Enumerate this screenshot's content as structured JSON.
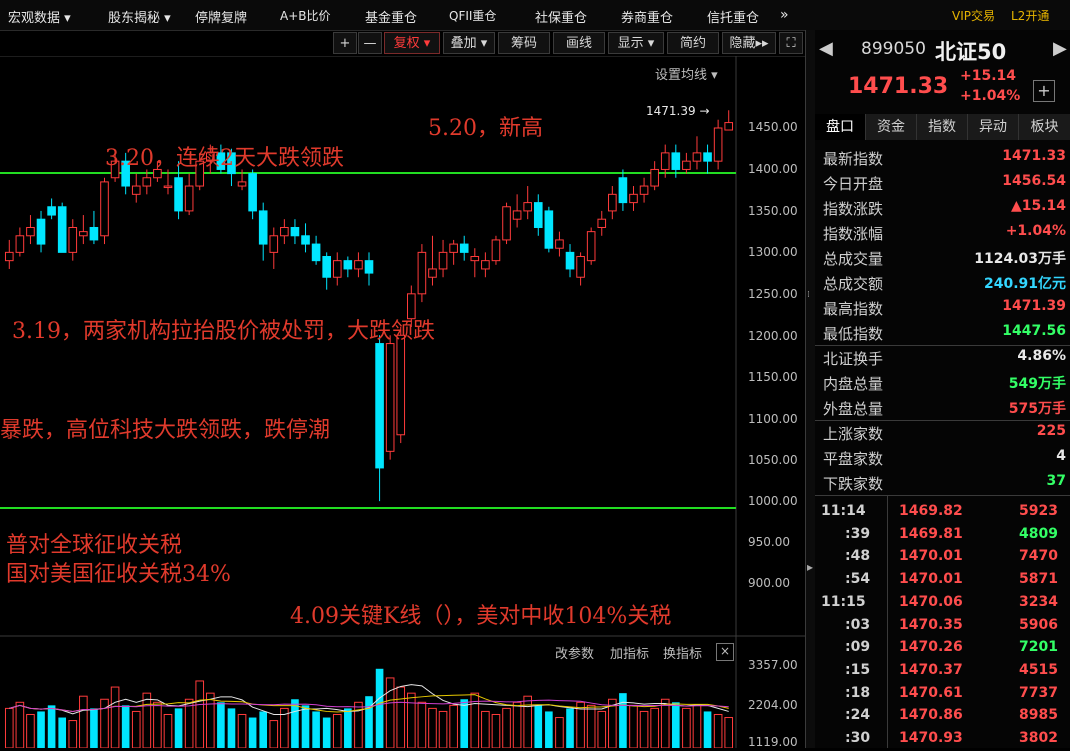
{
  "menu": {
    "items": [
      "宏观数据",
      "股东揭秘",
      "停牌复牌",
      "A+B比价",
      "基金重仓",
      "QFII重仓",
      "社保重仓",
      "券商重仓",
      "信托重仓"
    ],
    "more": "»",
    "vip": "VIP交易",
    "l2": "L2开通"
  },
  "toolbar": {
    "plus": "+",
    "minus": "—",
    "fuquan": "复权",
    "diejia": "叠加",
    "chouma": "筹码",
    "huaxian": "画线",
    "xianshi": "显示",
    "jianyue": "简约",
    "yincang": "隐藏",
    "settings": "设置均线 ▾"
  },
  "chart": {
    "price_axis": [
      "1450.00",
      "1400.00",
      "1350.00",
      "1300.00",
      "1250.00",
      "1200.00",
      "1150.00",
      "1100.00",
      "1050.00",
      "1000.00",
      "950.00",
      "900.00"
    ],
    "high_marker": "1471.39",
    "annotations": {
      "a1": "3.20，连续2天大跌领跌",
      "a2": "5.20，新高",
      "a3": "3.19，两家机构拉抬股价被处罚，大跌领跌",
      "a4": "暴跌，高位科技大跌领跌，跌停潮",
      "a5": "普对全球征收关税",
      "a6": "国对美国征收关税34%",
      "a7": "4.09关键K线（），美对中收104%关税"
    },
    "indicator_bar": {
      "gaicanshu": "改参数",
      "jiazhibiao": "加指标",
      "huanzhibiao": "换指标",
      "close": "×"
    },
    "volume_axis": [
      "3357.00",
      "2204.00",
      "1119.00"
    ],
    "colors": {
      "up": "#ff3b3b",
      "down": "#00e6ff",
      "line": "#22dd22",
      "annot": "#e03a2c"
    }
  },
  "chart_data": {
    "type": "candlestick",
    "ylim": [
      880,
      1490
    ],
    "candles": [
      [
        1290,
        1315,
        1280,
        1300
      ],
      [
        1300,
        1330,
        1295,
        1320
      ],
      [
        1320,
        1345,
        1310,
        1330
      ],
      [
        1340,
        1350,
        1300,
        1310
      ],
      [
        1355,
        1365,
        1340,
        1345
      ],
      [
        1355,
        1360,
        1300,
        1300
      ],
      [
        1300,
        1340,
        1290,
        1330
      ],
      [
        1320,
        1345,
        1310,
        1325
      ],
      [
        1330,
        1350,
        1310,
        1315
      ],
      [
        1320,
        1390,
        1310,
        1385
      ],
      [
        1390,
        1420,
        1385,
        1410
      ],
      [
        1410,
        1420,
        1370,
        1380
      ],
      [
        1370,
        1395,
        1360,
        1380
      ],
      [
        1380,
        1400,
        1370,
        1390
      ],
      [
        1390,
        1410,
        1385,
        1400
      ],
      [
        1380,
        1400,
        1370,
        1380
      ],
      [
        1390,
        1410,
        1340,
        1350
      ],
      [
        1350,
        1395,
        1345,
        1380
      ],
      [
        1380,
        1420,
        1375,
        1410
      ],
      [
        1410,
        1430,
        1395,
        1420
      ],
      [
        1420,
        1430,
        1395,
        1400
      ],
      [
        1420,
        1425,
        1380,
        1395
      ],
      [
        1380,
        1400,
        1375,
        1385
      ],
      [
        1395,
        1400,
        1340,
        1350
      ],
      [
        1350,
        1360,
        1290,
        1310
      ],
      [
        1300,
        1330,
        1280,
        1320
      ],
      [
        1320,
        1340,
        1310,
        1330
      ],
      [
        1330,
        1340,
        1310,
        1320
      ],
      [
        1320,
        1335,
        1300,
        1310
      ],
      [
        1310,
        1320,
        1285,
        1290
      ],
      [
        1295,
        1300,
        1255,
        1270
      ],
      [
        1270,
        1300,
        1260,
        1290
      ],
      [
        1290,
        1295,
        1270,
        1280
      ],
      [
        1280,
        1300,
        1270,
        1290
      ],
      [
        1290,
        1300,
        1260,
        1275
      ],
      [
        1190,
        1200,
        1000,
        1040
      ],
      [
        1060,
        1200,
        1050,
        1190
      ],
      [
        1080,
        1210,
        1070,
        1200
      ],
      [
        1220,
        1260,
        1210,
        1250
      ],
      [
        1250,
        1310,
        1240,
        1300
      ],
      [
        1270,
        1320,
        1260,
        1280
      ],
      [
        1280,
        1315,
        1270,
        1300
      ],
      [
        1300,
        1315,
        1285,
        1310
      ],
      [
        1310,
        1320,
        1290,
        1300
      ],
      [
        1290,
        1305,
        1270,
        1295
      ],
      [
        1280,
        1300,
        1270,
        1290
      ],
      [
        1290,
        1320,
        1285,
        1315
      ],
      [
        1315,
        1360,
        1310,
        1355
      ],
      [
        1340,
        1370,
        1330,
        1350
      ],
      [
        1350,
        1380,
        1340,
        1360
      ],
      [
        1360,
        1370,
        1320,
        1330
      ],
      [
        1350,
        1355,
        1300,
        1305
      ],
      [
        1305,
        1325,
        1295,
        1315
      ],
      [
        1300,
        1310,
        1270,
        1280
      ],
      [
        1270,
        1300,
        1260,
        1295
      ],
      [
        1290,
        1330,
        1285,
        1325
      ],
      [
        1330,
        1350,
        1320,
        1340
      ],
      [
        1350,
        1380,
        1340,
        1370
      ],
      [
        1390,
        1400,
        1350,
        1360
      ],
      [
        1360,
        1380,
        1350,
        1370
      ],
      [
        1370,
        1390,
        1360,
        1380
      ],
      [
        1380,
        1410,
        1375,
        1400
      ],
      [
        1400,
        1430,
        1390,
        1420
      ],
      [
        1420,
        1430,
        1390,
        1400
      ],
      [
        1400,
        1420,
        1395,
        1410
      ],
      [
        1410,
        1440,
        1400,
        1420
      ],
      [
        1420,
        1430,
        1395,
        1410
      ],
      [
        1410,
        1460,
        1400,
        1450
      ],
      [
        1447.56,
        1471.39,
        1447.56,
        1456.54
      ]
    ],
    "volume": [
      1900,
      2100,
      1700,
      1800,
      2000,
      1600,
      1500,
      2300,
      1900,
      2200,
      2600,
      2000,
      1800,
      2400,
      2100,
      1700,
      1900,
      2200,
      2800,
      2400,
      2100,
      1900,
      1700,
      1600,
      1800,
      1500,
      1900,
      2200,
      2000,
      1800,
      1600,
      1700,
      1900,
      2100,
      2300,
      3200,
      2900,
      2600,
      2400,
      2100,
      1900,
      1800,
      2000,
      2200,
      2400,
      1800,
      1700,
      1900,
      2100,
      2300,
      2000,
      1800,
      1600,
      1900,
      2100,
      2000,
      1800,
      2200,
      2400,
      2000,
      1800,
      1900,
      2200,
      2100,
      1900,
      2000,
      1800,
      1700,
      1600
    ],
    "volume_ylim": [
      1119,
      3357
    ]
  },
  "panel": {
    "code": "899050",
    "name": "北证50",
    "price": "1471.33",
    "change": "+15.14",
    "change_pct": "+1.04%",
    "plus_btn": "+",
    "tabs": [
      "盘口",
      "资金",
      "指数",
      "异动",
      "板块"
    ],
    "stats": [
      {
        "k": "最新指数",
        "v": "1471.33",
        "c": "#ff4d4d"
      },
      {
        "k": "今日开盘",
        "v": "1456.54",
        "c": "#ff4d4d"
      },
      {
        "k": "指数涨跌",
        "v": "▲15.14",
        "c": "#ff4d4d"
      },
      {
        "k": "指数涨幅",
        "v": "+1.04%",
        "c": "#ff4d4d"
      },
      {
        "k": "总成交量",
        "v": "1124.03万手",
        "c": "#e8e8e8"
      },
      {
        "k": "总成交额",
        "v": "240.91亿元",
        "c": "#33d6ff"
      },
      {
        "k": "最高指数",
        "v": "1471.39",
        "c": "#ff4d4d"
      },
      {
        "k": "最低指数",
        "v": "1447.56",
        "c": "#33ff66"
      },
      {
        "k": "北证换手",
        "v": "4.86%",
        "c": "#e8e8e8"
      },
      {
        "k": "内盘总量",
        "v": "549万手",
        "c": "#33ff66"
      },
      {
        "k": "外盘总量",
        "v": "575万手",
        "c": "#ff4d4d"
      },
      {
        "k": "上涨家数",
        "v": "225",
        "c": "#ff4d4d"
      },
      {
        "k": "平盘家数",
        "v": "4",
        "c": "#e8e8e8"
      },
      {
        "k": "下跌家数",
        "v": "37",
        "c": "#33ff66"
      }
    ],
    "ticks": [
      {
        "t": "11:14",
        "p": "1469.82",
        "v": "5923",
        "c": "#ff4d4d"
      },
      {
        "t": ":39",
        "p": "1469.81",
        "v": "4809",
        "c": "#33ff66"
      },
      {
        "t": ":48",
        "p": "1470.01",
        "v": "7470",
        "c": "#ff4d4d"
      },
      {
        "t": ":54",
        "p": "1470.01",
        "v": "5871",
        "c": "#ff4d4d"
      },
      {
        "t": "11:15",
        "p": "1470.06",
        "v": "3234",
        "c": "#ff4d4d"
      },
      {
        "t": ":03",
        "p": "1470.35",
        "v": "5906",
        "c": "#ff4d4d"
      },
      {
        "t": ":09",
        "p": "1470.26",
        "v": "7201",
        "c": "#33ff66"
      },
      {
        "t": ":15",
        "p": "1470.37",
        "v": "4515",
        "c": "#ff4d4d"
      },
      {
        "t": ":18",
        "p": "1470.61",
        "v": "7737",
        "c": "#ff4d4d"
      },
      {
        "t": ":24",
        "p": "1470.86",
        "v": "8985",
        "c": "#ff4d4d"
      },
      {
        "t": ":30",
        "p": "1470.93",
        "v": "3802",
        "c": "#ff4d4d"
      }
    ]
  }
}
